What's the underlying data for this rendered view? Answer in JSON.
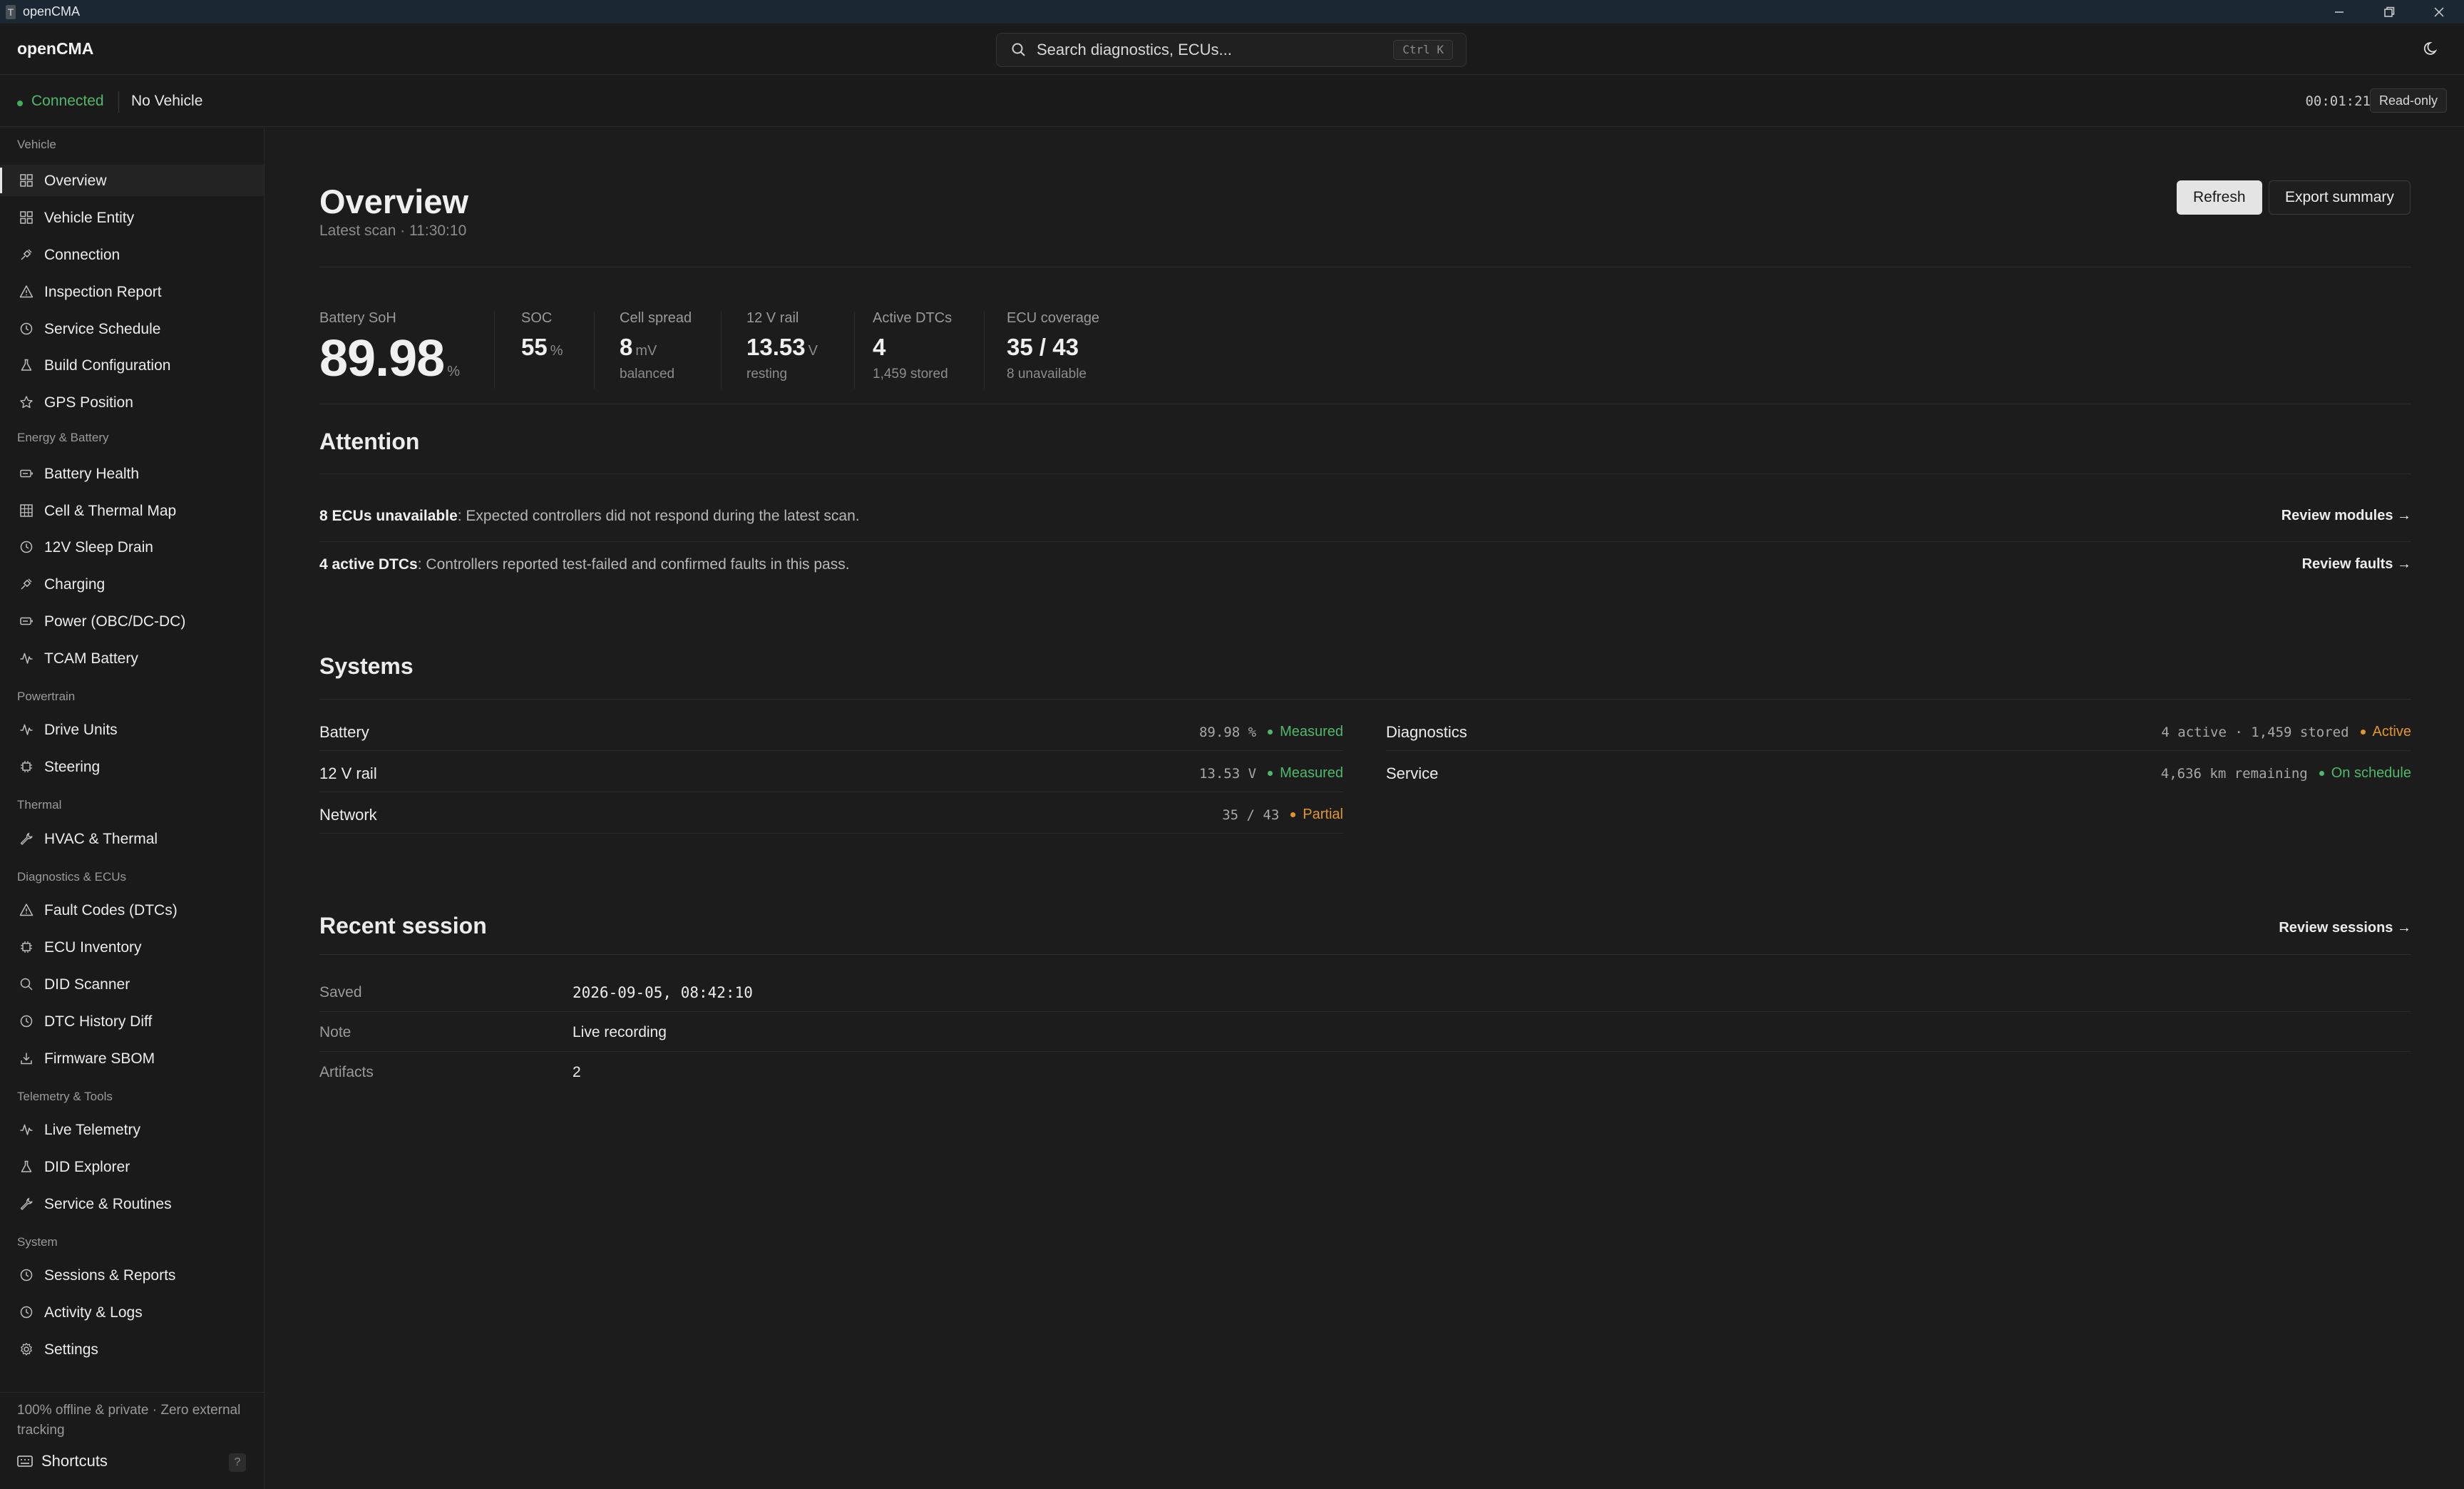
{
  "window": {
    "title": "openCMA",
    "app_icon": "terminal-icon"
  },
  "header": {
    "brand": "openCMA",
    "search": {
      "placeholder": "Search diagnostics, ECUs...",
      "shortcut": "Ctrl K"
    },
    "theme_toggle_icon": "moon-icon"
  },
  "status": {
    "connection": "Connected",
    "vehicle": "No Vehicle",
    "timer": "00:01:21",
    "mode": "Read-only"
  },
  "sidebar": {
    "groups": [
      {
        "label": "Vehicle",
        "items": [
          {
            "label": "Overview",
            "icon": "grid-icon"
          },
          {
            "label": "Vehicle Entity",
            "icon": "grid-icon"
          },
          {
            "label": "Connection",
            "icon": "plug-icon"
          },
          {
            "label": "Inspection Report",
            "icon": "warning-icon"
          },
          {
            "label": "Service Schedule",
            "icon": "clock-icon"
          },
          {
            "label": "Build Configuration",
            "icon": "flask-icon"
          },
          {
            "label": "GPS Position",
            "icon": "star-icon"
          }
        ]
      },
      {
        "label": "Energy & Battery",
        "items": [
          {
            "label": "Battery Health",
            "icon": "battery-icon"
          },
          {
            "label": "Cell & Thermal Map",
            "icon": "table-icon"
          },
          {
            "label": "12V Sleep Drain",
            "icon": "clock-icon"
          },
          {
            "label": "Charging",
            "icon": "plug-icon"
          },
          {
            "label": "Power (OBC/DC-DC)",
            "icon": "battery-icon"
          },
          {
            "label": "TCAM Battery",
            "icon": "pulse-icon"
          }
        ]
      },
      {
        "label": "Powertrain",
        "items": [
          {
            "label": "Drive Units",
            "icon": "pulse-icon"
          },
          {
            "label": "Steering",
            "icon": "chip-icon"
          }
        ]
      },
      {
        "label": "Thermal",
        "items": [
          {
            "label": "HVAC & Thermal",
            "icon": "wrench-icon"
          }
        ]
      },
      {
        "label": "Diagnostics & ECUs",
        "items": [
          {
            "label": "Fault Codes (DTCs)",
            "icon": "warning-icon"
          },
          {
            "label": "ECU Inventory",
            "icon": "chip-icon"
          },
          {
            "label": "DID Scanner",
            "icon": "search-icon"
          },
          {
            "label": "DTC History Diff",
            "icon": "clock-icon"
          },
          {
            "label": "Firmware SBOM",
            "icon": "download-icon"
          }
        ]
      },
      {
        "label": "Telemetry & Tools",
        "items": [
          {
            "label": "Live Telemetry",
            "icon": "pulse-icon"
          },
          {
            "label": "DID Explorer",
            "icon": "flask-icon"
          },
          {
            "label": "Service & Routines",
            "icon": "wrench-icon"
          }
        ]
      },
      {
        "label": "System",
        "items": [
          {
            "label": "Sessions & Reports",
            "icon": "clock-icon"
          },
          {
            "label": "Activity & Logs",
            "icon": "clock-icon"
          },
          {
            "label": "Settings",
            "icon": "gear-icon"
          }
        ]
      }
    ],
    "footnote": "100% offline & private · Zero external tracking",
    "shortcuts_label": "Shortcuts",
    "shortcuts_key": "?"
  },
  "overview": {
    "title": "Overview",
    "subtitle": "Latest scan · 11:30:10",
    "refresh": "Refresh",
    "export": "Export summary",
    "metrics": {
      "soh": {
        "label": "Battery SoH",
        "value": "89.98",
        "unit": "%"
      },
      "soc": {
        "label": "SOC",
        "value": "55",
        "unit": "%"
      },
      "cell": {
        "label": "Cell spread",
        "value": "8",
        "unit": "mV",
        "sub": "balanced"
      },
      "rail": {
        "label": "12 V rail",
        "value": "13.53",
        "unit": "V",
        "sub": "resting"
      },
      "dtc": {
        "label": "Active DTCs",
        "value": "4",
        "sub": "1,459 stored"
      },
      "ecu": {
        "label": "ECU coverage",
        "value": "35 / 43",
        "sub": "8 unavailable"
      }
    },
    "attention": {
      "title": "Attention",
      "rows": [
        {
          "strong": "8 ECUs unavailable",
          "text": ": Expected controllers did not respond during the latest scan.",
          "link": "Review modules →"
        },
        {
          "strong": "4 active DTCs",
          "text": ": Controllers reported test-failed and confirmed faults in this pass.",
          "link": "Review faults →"
        }
      ]
    },
    "systems": {
      "title": "Systems",
      "left": [
        {
          "name": "Battery",
          "value": "89.98 %",
          "status": "Measured",
          "color": "#4fb86a"
        },
        {
          "name": "12 V rail",
          "value": "13.53 V",
          "status": "Measured",
          "color": "#4fb86a"
        },
        {
          "name": "Network",
          "value": "35 / 43",
          "status": "Partial",
          "color": "#e0962e"
        }
      ],
      "right": [
        {
          "name": "Diagnostics",
          "value": "4 active · 1,459 stored",
          "status": "Active",
          "color": "#e0962e"
        },
        {
          "name": "Service",
          "value": "4,636 km remaining",
          "status": "On schedule",
          "color": "#4fb86a"
        }
      ]
    },
    "session": {
      "title": "Recent session",
      "link": "Review sessions →",
      "rows": [
        {
          "key": "Saved",
          "value": "2026-09-05, 08:42:10"
        },
        {
          "key": "Note",
          "value": "Live recording"
        },
        {
          "key": "Artifacts",
          "value": "2"
        }
      ]
    }
  },
  "colors": {
    "ok": "#4fb86a",
    "warn": "#e0962e",
    "background": "#1c1c1c"
  }
}
